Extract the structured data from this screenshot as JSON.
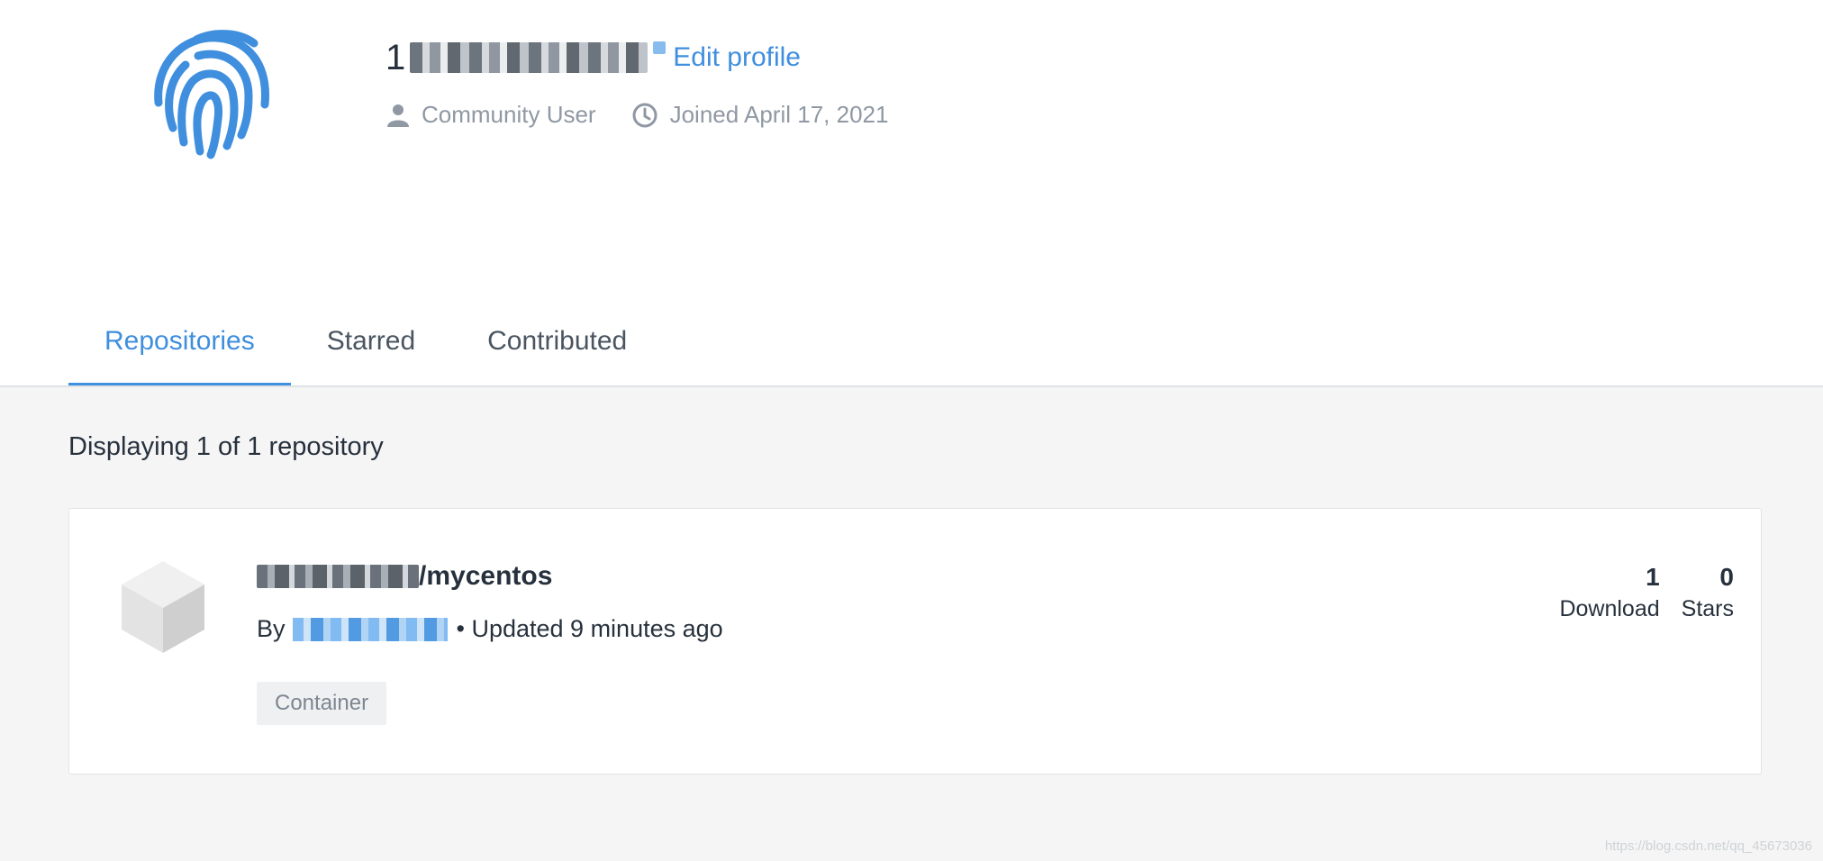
{
  "profile": {
    "username_prefix": "1",
    "edit_label": "Edit profile",
    "role": "Community User",
    "joined": "Joined April 17, 2021",
    "icons": {
      "avatar": "fingerprint-icon",
      "role": "user-icon",
      "joined": "clock-icon"
    },
    "accent_color": "#3f8fde"
  },
  "tabs": [
    {
      "label": "Repositories",
      "active": true
    },
    {
      "label": "Starred",
      "active": false
    },
    {
      "label": "Contributed",
      "active": false
    }
  ],
  "listing": {
    "count_text": "Displaying 1 of 1 repository"
  },
  "repo": {
    "name_suffix": "/mycentos",
    "by_label": "By",
    "updated": "• Updated 9 minutes ago",
    "badge": "Container",
    "icon": "cube-icon",
    "downloads_value": "1",
    "downloads_label": "Download",
    "stars_value": "0",
    "stars_label": "Stars"
  },
  "watermark": "https://blog.csdn.net/qq_45673036"
}
